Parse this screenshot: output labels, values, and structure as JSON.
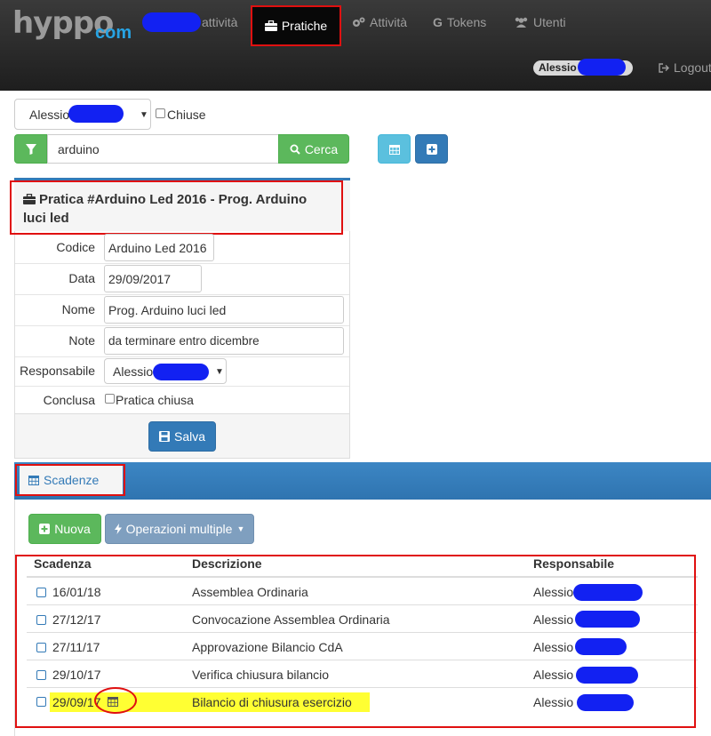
{
  "nav": {
    "logo_main": "hyppo",
    "logo_suffix": "com",
    "user_activities": "attività",
    "active_tab": "Pratiche",
    "items": [
      "Attività",
      "Tokens",
      "Utenti"
    ],
    "user_name": "Alessio",
    "logout": "Logout"
  },
  "filter": {
    "user_select": "Alessio",
    "closed_label": "Chiuse",
    "search_value": "arduino",
    "search_button": "Cerca"
  },
  "pratica": {
    "title": "Pratica #Arduino Led 2016 - Prog. Arduino luci led",
    "fields": [
      {
        "label": "Codice",
        "value": "Arduino Led 2016"
      },
      {
        "label": "Data",
        "value": "29/09/2017"
      },
      {
        "label": "Nome",
        "value": "Prog. Arduino luci led"
      },
      {
        "label": "Note",
        "value": "da terminare entro dicembre"
      }
    ],
    "responsabile_label": "Responsabile",
    "responsabile_value": "Alessio",
    "conclusa_label": "Conclusa",
    "conclusa_checkbox": "Pratica chiusa",
    "save_button": "Salva"
  },
  "scadenze": {
    "title": "Scadenze",
    "new_button": "Nuova",
    "multi_button": "Operazioni multiple",
    "columns": [
      "Scadenza",
      "Descrizione",
      "Responsabile"
    ],
    "rows": [
      {
        "date": "16/01/18",
        "desc": "Assemblea Ordinaria",
        "resp": "Alessio"
      },
      {
        "date": "27/12/17",
        "desc": "Convocazione Assemblea Ordinaria",
        "resp": "Alessio"
      },
      {
        "date": "27/11/17",
        "desc": "Approvazione Bilancio CdA",
        "resp": "Alessio"
      },
      {
        "date": "29/10/17",
        "desc": "Verifica chiusura bilancio",
        "resp": "Alessio"
      },
      {
        "date": "29/09/17",
        "desc": "Bilancio di chiusura esercizio",
        "resp": "Alessio"
      }
    ]
  },
  "colors": {
    "navbar": "#222222",
    "primary": "#337ab7",
    "success": "#5cb85c",
    "info": "#5bc0de",
    "highlight": "#ffff33",
    "annotation": "#e01010",
    "redaction": "#1221f2"
  },
  "icons": [
    "filter-icon",
    "search-icon",
    "calendar-icon",
    "plus-icon",
    "briefcase-icon",
    "cogs-icon",
    "google-icon",
    "users-icon",
    "logout-icon",
    "save-icon",
    "bolt-icon"
  ]
}
